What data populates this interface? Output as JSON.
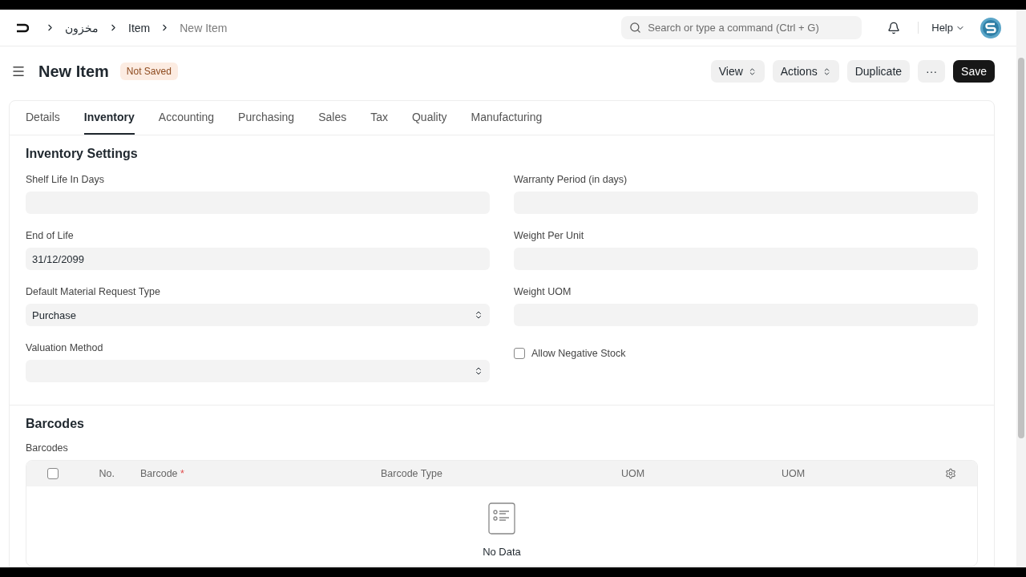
{
  "navbar": {
    "breadcrumbs": [
      "مخزون",
      "Item",
      "New Item"
    ],
    "search": {
      "placeholder": "Search or type a command (Ctrl + G)"
    },
    "help": "Help"
  },
  "page": {
    "title": "New Item",
    "status": "Not Saved",
    "buttons": [
      {
        "label": "View",
        "kind": "dropdown"
      },
      {
        "label": "Actions",
        "kind": "dropdown"
      },
      {
        "label": "Duplicate",
        "kind": "plain"
      },
      {
        "label": "···",
        "kind": "plain"
      },
      {
        "label": "Save",
        "kind": "primary"
      }
    ]
  },
  "tabs": [
    {
      "label": "Details",
      "selected": false
    },
    {
      "label": "Inventory",
      "selected": true
    },
    {
      "label": "Accounting",
      "selected": false
    },
    {
      "label": "Purchasing",
      "selected": false
    },
    {
      "label": "Sales",
      "selected": false
    },
    {
      "label": "Tax",
      "selected": false
    },
    {
      "label": "Quality",
      "selected": false
    },
    {
      "label": "Manufacturing",
      "selected": false
    }
  ],
  "inventory_settings": {
    "title": "Inventory Settings",
    "left": [
      {
        "kind": "text",
        "label": "Shelf Life In Days"
      },
      {
        "kind": "text",
        "label": "End of Life",
        "value": "31/12/2099"
      },
      {
        "kind": "select",
        "label": "Default Material Request Type",
        "value": "Purchase"
      },
      {
        "kind": "select",
        "label": "Valuation Method"
      }
    ],
    "right": [
      {
        "kind": "text",
        "label": "Warranty Period (in days)"
      },
      {
        "kind": "text",
        "label": "Weight Per Unit"
      },
      {
        "kind": "text",
        "label": "Weight UOM"
      },
      {
        "kind": "checkbox",
        "label": "Allow Negative Stock",
        "checked": false
      }
    ]
  },
  "barcodes": {
    "title": "Barcodes",
    "table_label": "Barcodes",
    "select_all": {
      "checked": false
    },
    "columns": [
      {
        "label": "No."
      },
      {
        "label": "Barcode",
        "required_mark": "*"
      },
      {
        "label": "Barcode Type"
      },
      {
        "label": "UOM"
      },
      {
        "label": "UOM"
      }
    ],
    "empty_text": "No Data"
  }
}
